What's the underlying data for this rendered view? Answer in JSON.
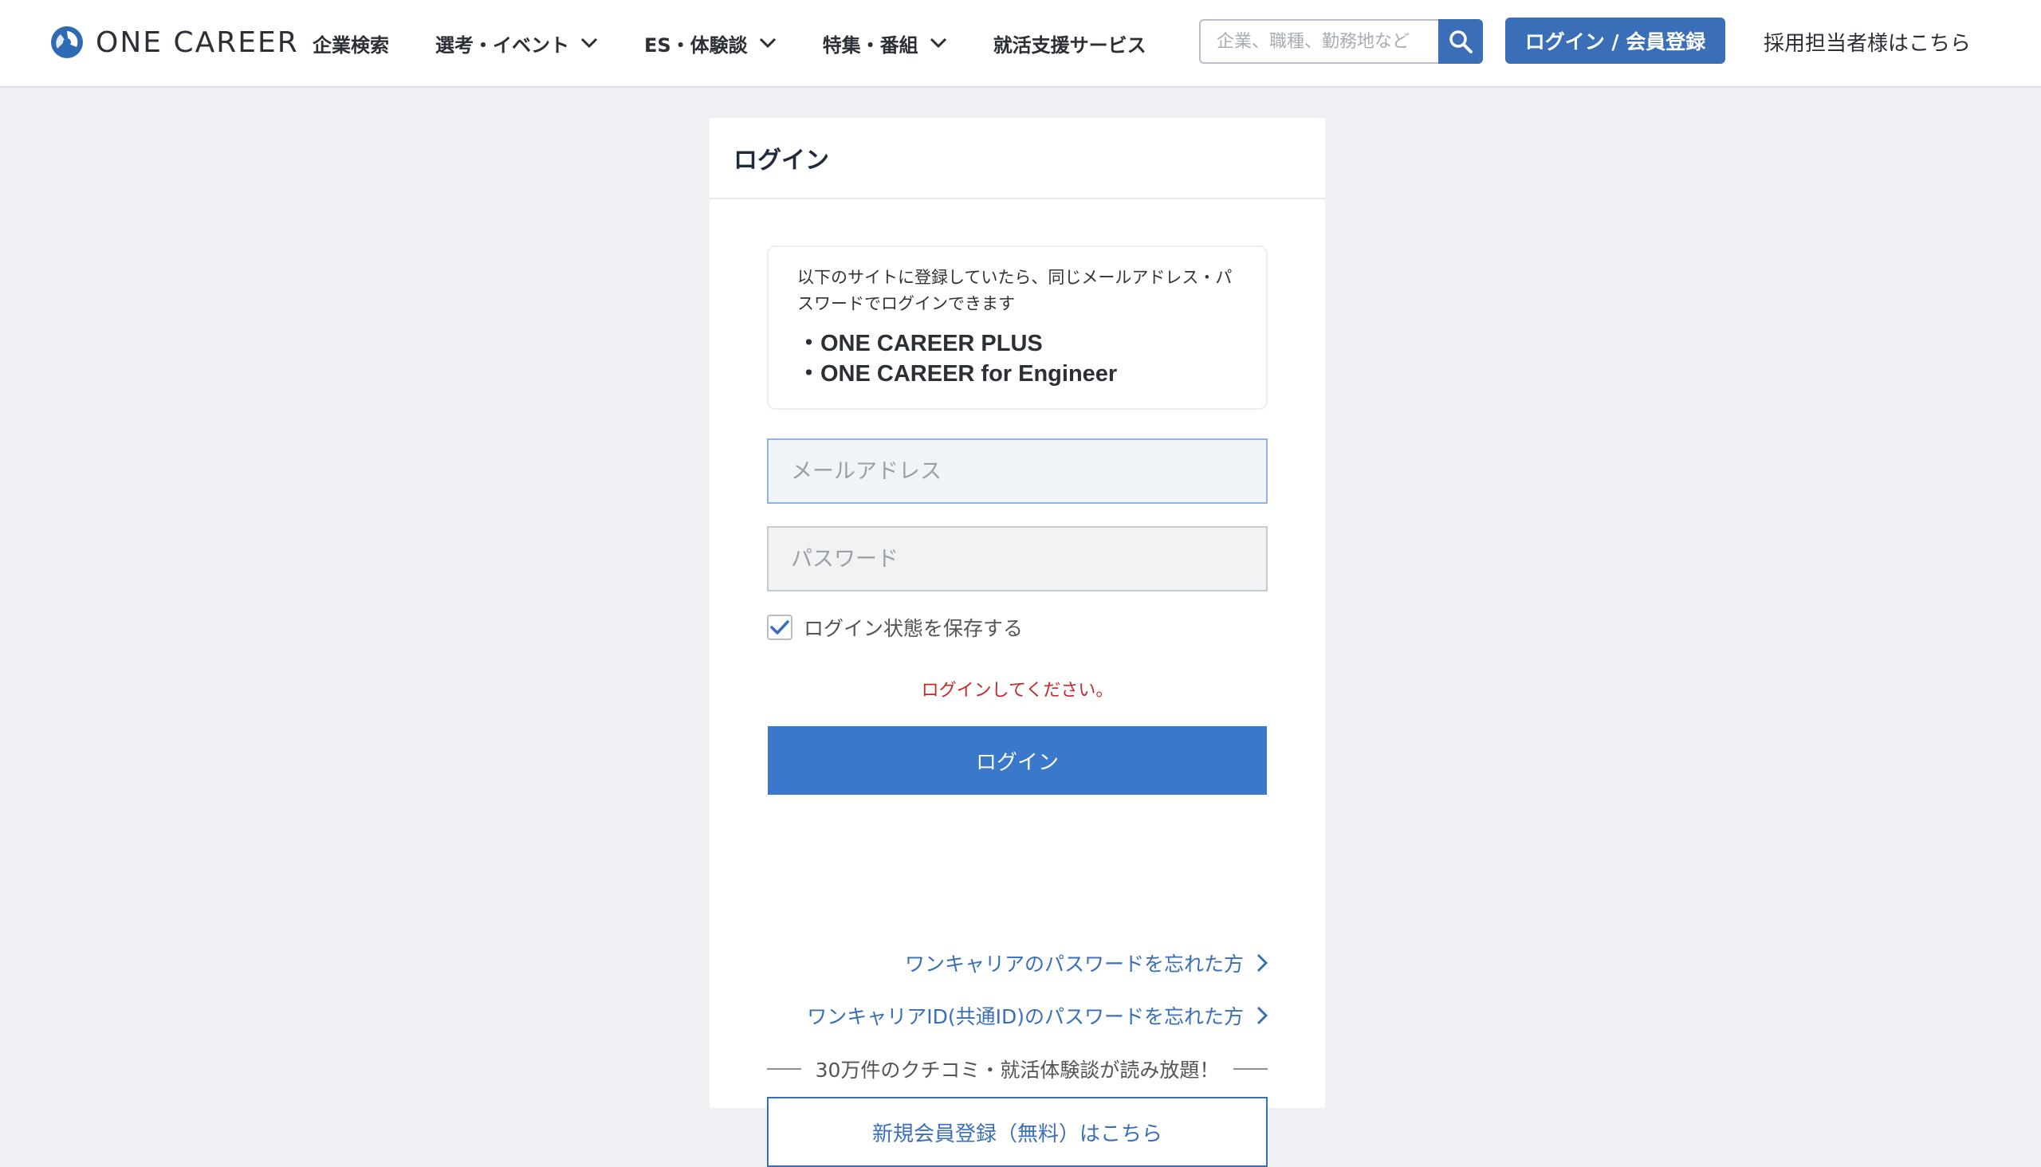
{
  "header": {
    "logo_text": "ONE CAREER",
    "logo_icon": "onecareer-logo-icon",
    "nav": [
      {
        "label": "企業検索",
        "has_dropdown": false
      },
      {
        "label": "選考・イベント",
        "has_dropdown": true
      },
      {
        "label": "ES・体験談",
        "has_dropdown": true
      },
      {
        "label": "特集・番組",
        "has_dropdown": true
      },
      {
        "label": "就活支援サービス",
        "has_dropdown": false
      }
    ],
    "search": {
      "placeholder": "企業、職種、勤務地など",
      "value": "",
      "icon": "search-icon"
    },
    "login_button": "ログイン / 会員登録",
    "recruiter_link": "採用担当者様はこちら"
  },
  "login_card": {
    "title": "ログイン",
    "notice": {
      "text": "以下のサイトに登録していたら、同じメールアドレス・パスワードでログインできます",
      "sites": [
        "・ONE CAREER PLUS",
        "・ONE CAREER for Engineer"
      ]
    },
    "email": {
      "placeholder": "メールアドレス",
      "value": ""
    },
    "password": {
      "placeholder": "パスワード",
      "value": ""
    },
    "remember": {
      "label": "ログイン状態を保存する",
      "checked": true
    },
    "error_message": "ログインしてください。",
    "submit_label": "ログイン",
    "forgot_links": [
      "ワンキャリアのパスワードを忘れた方",
      "ワンキャリアID(共通ID)のパスワードを忘れた方"
    ],
    "divider_text": "30万件のクチコミ・就活体験談が読み放題！",
    "register_label": "新規会員登録（無料）はこちら"
  },
  "colors": {
    "accent": "#3a6fb8",
    "submit": "#3a78cc",
    "error": "#c62828",
    "background": "#eef0f3"
  }
}
